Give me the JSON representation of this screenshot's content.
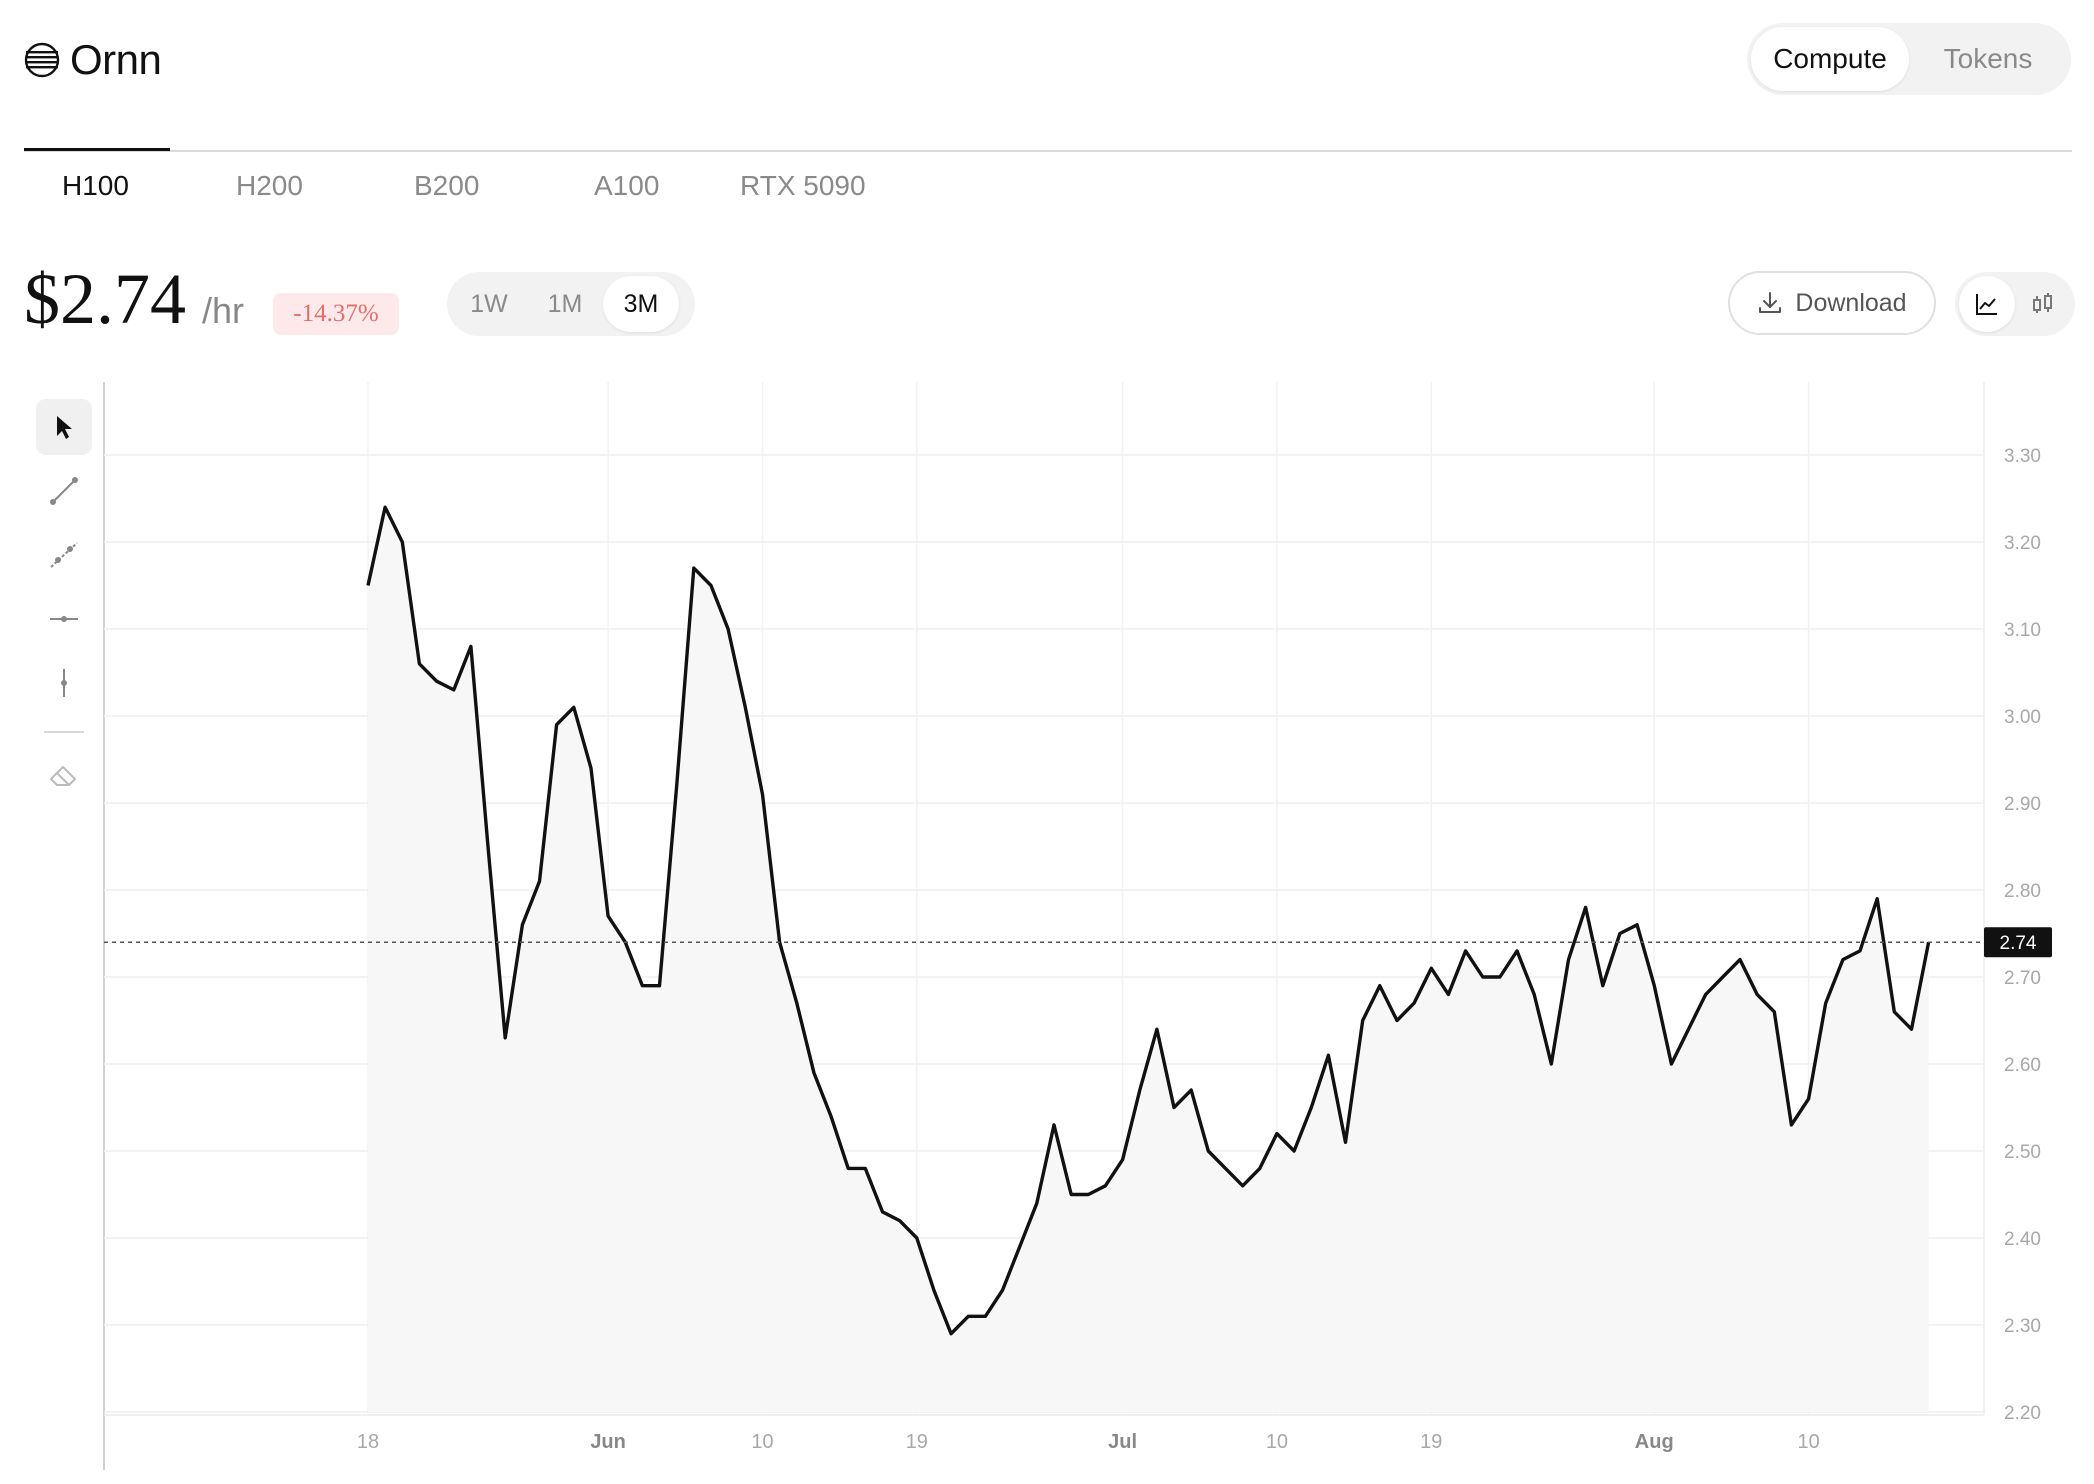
{
  "app": {
    "name": "Ornn"
  },
  "mode_switch": {
    "options": [
      "Compute",
      "Tokens"
    ],
    "active": "Compute"
  },
  "gpu_tabs": {
    "items": [
      "H100",
      "H200",
      "B200",
      "A100",
      "RTX 5090"
    ],
    "active": "H100"
  },
  "price": {
    "value": "$2.74",
    "unit": "/hr",
    "change": "-14.37%"
  },
  "range_selector": {
    "options": [
      "1W",
      "1M",
      "3M"
    ],
    "active": "3M"
  },
  "download": {
    "label": "Download"
  },
  "view_modes": [
    "line-chart-icon",
    "candlestick-icon"
  ],
  "drawing_tools": [
    "cursor-icon",
    "trend-line-icon",
    "ray-icon",
    "horizontal-line-icon",
    "vertical-line-icon",
    "eraser-icon"
  ],
  "colors": {
    "line": "#111111",
    "change_bg": "#fde9e9",
    "change_text": "#e0706c",
    "last_price_bg": "#111111"
  },
  "chart_data": {
    "type": "line",
    "last_value_label": "2.74",
    "ylim": [
      2.2,
      3.3
    ],
    "yticks": [
      "3.30",
      "3.20",
      "3.10",
      "3.00",
      "2.90",
      "2.80",
      "2.70",
      "2.60",
      "2.50",
      "2.40",
      "2.30",
      "2.20"
    ],
    "xticks": [
      {
        "label": "18",
        "day": 0,
        "bold": false
      },
      {
        "label": "Jun",
        "day": 14,
        "bold": true
      },
      {
        "label": "10",
        "day": 23,
        "bold": false
      },
      {
        "label": "19",
        "day": 32,
        "bold": false
      },
      {
        "label": "Jul",
        "day": 44,
        "bold": true
      },
      {
        "label": "10",
        "day": 53,
        "bold": false
      },
      {
        "label": "19",
        "day": 62,
        "bold": false
      },
      {
        "label": "Aug",
        "day": 75,
        "bold": true
      },
      {
        "label": "10",
        "day": 84,
        "bold": false
      }
    ],
    "grid": true,
    "values": [
      3.15,
      3.24,
      3.2,
      3.06,
      3.04,
      3.03,
      3.08,
      2.85,
      2.63,
      2.76,
      2.81,
      2.99,
      3.01,
      2.94,
      2.77,
      2.74,
      2.69,
      2.69,
      2.92,
      3.17,
      3.15,
      3.1,
      3.01,
      2.91,
      2.74,
      2.67,
      2.59,
      2.54,
      2.48,
      2.48,
      2.43,
      2.42,
      2.4,
      2.34,
      2.29,
      2.31,
      2.31,
      2.34,
      2.39,
      2.44,
      2.53,
      2.45,
      2.45,
      2.46,
      2.49,
      2.57,
      2.64,
      2.55,
      2.57,
      2.5,
      2.48,
      2.46,
      2.48,
      2.52,
      2.5,
      2.55,
      2.61,
      2.51,
      2.65,
      2.69,
      2.65,
      2.67,
      2.71,
      2.68,
      2.73,
      2.7,
      2.7,
      2.73,
      2.68,
      2.6,
      2.72,
      2.78,
      2.69,
      2.75,
      2.76,
      2.69,
      2.6,
      2.64,
      2.68,
      2.7,
      2.72,
      2.68,
      2.66,
      2.53,
      2.56,
      2.67,
      2.72,
      2.73,
      2.79,
      2.66,
      2.64,
      2.74
    ]
  }
}
